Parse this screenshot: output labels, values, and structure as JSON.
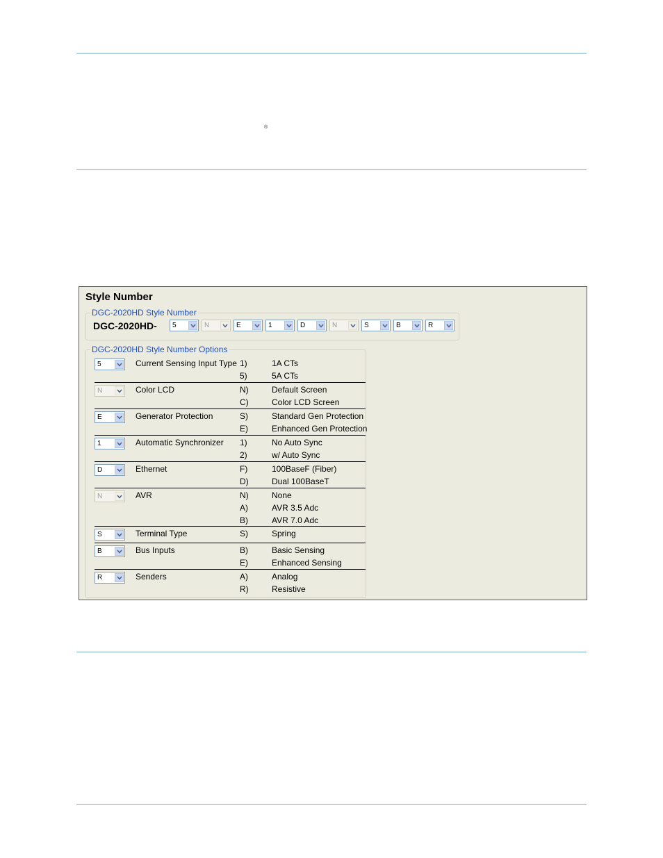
{
  "registered_mark": "®",
  "panel": {
    "title": "Style Number",
    "style_group": {
      "caption": "DGC-2020HD Style Number",
      "prefix": "DGC-2020HD-",
      "selectors": [
        {
          "value": "5",
          "enabled": true
        },
        {
          "value": "N",
          "enabled": false
        },
        {
          "value": "E",
          "enabled": true
        },
        {
          "value": "1",
          "enabled": true
        },
        {
          "value": "D",
          "enabled": true
        },
        {
          "value": "N",
          "enabled": false
        },
        {
          "value": "S",
          "enabled": true
        },
        {
          "value": "B",
          "enabled": true
        },
        {
          "value": "R",
          "enabled": true
        }
      ]
    },
    "options_group": {
      "caption": "DGC-2020HD Style Number Options",
      "rows": [
        {
          "value": "5",
          "enabled": true,
          "label": "Current Sensing Input Type",
          "choices": [
            {
              "code": "1)",
              "desc": "1A CTs"
            },
            {
              "code": "5)",
              "desc": "5A CTs"
            }
          ]
        },
        {
          "value": "N",
          "enabled": false,
          "label": "Color LCD",
          "choices": [
            {
              "code": "N)",
              "desc": "Default Screen"
            },
            {
              "code": "C)",
              "desc": "Color LCD Screen"
            }
          ]
        },
        {
          "value": "E",
          "enabled": true,
          "label": "Generator Protection",
          "choices": [
            {
              "code": "S)",
              "desc": "Standard Gen Protection"
            },
            {
              "code": "E)",
              "desc": "Enhanced Gen Protection"
            }
          ]
        },
        {
          "value": "1",
          "enabled": true,
          "label": "Automatic Synchronizer",
          "choices": [
            {
              "code": "1)",
              "desc": "No Auto Sync"
            },
            {
              "code": "2)",
              "desc": "w/ Auto Sync"
            }
          ]
        },
        {
          "value": "D",
          "enabled": true,
          "label": "Ethernet",
          "choices": [
            {
              "code": "F)",
              "desc": "100BaseF (Fiber)"
            },
            {
              "code": "D)",
              "desc": "Dual 100BaseT"
            }
          ]
        },
        {
          "value": "N",
          "enabled": false,
          "label": "AVR",
          "choices": [
            {
              "code": "N)",
              "desc": "None"
            },
            {
              "code": "A)",
              "desc": "AVR 3.5 Adc"
            },
            {
              "code": "B)",
              "desc": "AVR 7.0 Adc"
            }
          ]
        },
        {
          "value": "S",
          "enabled": true,
          "label": "Terminal Type",
          "choices": [
            {
              "code": "S)",
              "desc": "Spring"
            }
          ]
        },
        {
          "value": "B",
          "enabled": true,
          "label": "Bus Inputs",
          "choices": [
            {
              "code": "B)",
              "desc": "Basic Sensing"
            },
            {
              "code": "E)",
              "desc": "Enhanced Sensing"
            }
          ]
        },
        {
          "value": "R",
          "enabled": true,
          "label": "Senders",
          "choices": [
            {
              "code": "A)",
              "desc": "Analog"
            },
            {
              "code": "R)",
              "desc": "Resistive"
            }
          ]
        }
      ]
    }
  }
}
